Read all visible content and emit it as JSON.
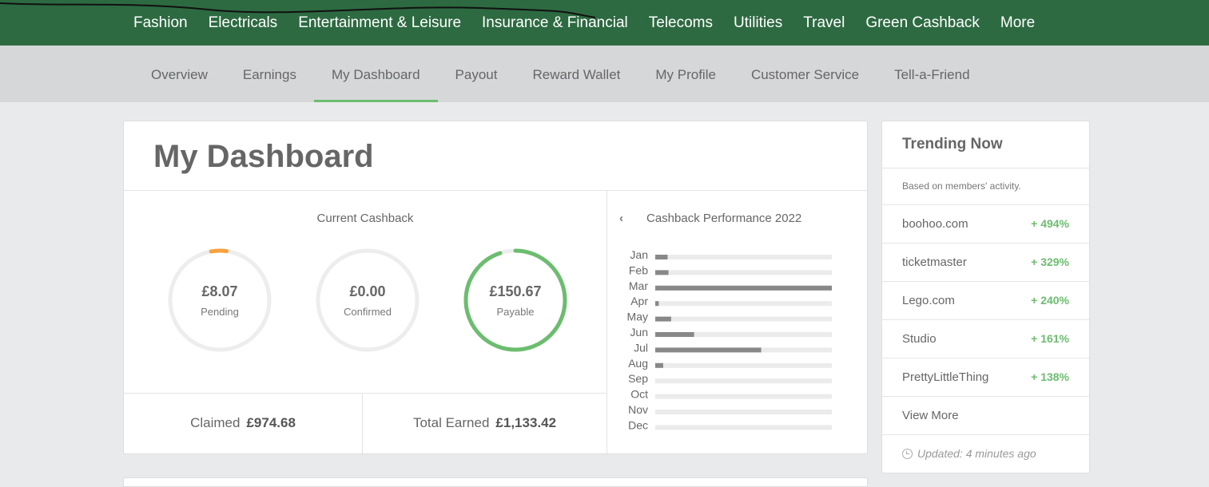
{
  "top_nav": [
    "Fashion",
    "Electricals",
    "Entertainment & Leisure",
    "Insurance & Financial",
    "Telecoms",
    "Utilities",
    "Travel",
    "Green Cashback",
    "More"
  ],
  "sub_nav": [
    "Overview",
    "Earnings",
    "My Dashboard",
    "Payout",
    "Reward Wallet",
    "My Profile",
    "Customer Service",
    "Tell-a-Friend"
  ],
  "active_sub_nav": "My Dashboard",
  "dashboard": {
    "title": "My Dashboard",
    "current_cashback_label": "Current Cashback",
    "rings": [
      {
        "amount": "£8.07",
        "label": "Pending",
        "fraction": 0.05,
        "color": "#f5a340"
      },
      {
        "amount": "£0.00",
        "label": "Confirmed",
        "fraction": 0.0,
        "color": "#6cbd6f"
      },
      {
        "amount": "£150.67",
        "label": "Payable",
        "fraction": 0.95,
        "color": "#6cbd6f"
      }
    ],
    "claimed_label": "Claimed",
    "claimed_value": "£974.68",
    "total_label": "Total Earned",
    "total_value": "£1,133.42"
  },
  "chart_data": {
    "type": "bar",
    "title": "Cashback Performance 2022",
    "categories": [
      "Jan",
      "Feb",
      "Mar",
      "Apr",
      "May",
      "Jun",
      "Jul",
      "Aug",
      "Sep",
      "Oct",
      "Nov",
      "Dec"
    ],
    "values": [
      0.07,
      0.075,
      1.0,
      0.02,
      0.09,
      0.22,
      0.6,
      0.045,
      0,
      0,
      0,
      0
    ],
    "xlim": [
      0,
      1
    ],
    "bar_color": "#888888",
    "track_color": "#ebebeb"
  },
  "trending": {
    "title": "Trending Now",
    "subtitle": "Based on members' activity.",
    "items": [
      {
        "name": "boohoo.com",
        "pct": "+ 494%"
      },
      {
        "name": "ticketmaster",
        "pct": "+ 329%"
      },
      {
        "name": "Lego.com",
        "pct": "+ 240%"
      },
      {
        "name": "Studio",
        "pct": "+ 161%"
      },
      {
        "name": "PrettyLittleThing",
        "pct": "+ 138%"
      }
    ],
    "view_more": "View More",
    "updated": "Updated: 4 minutes ago"
  }
}
